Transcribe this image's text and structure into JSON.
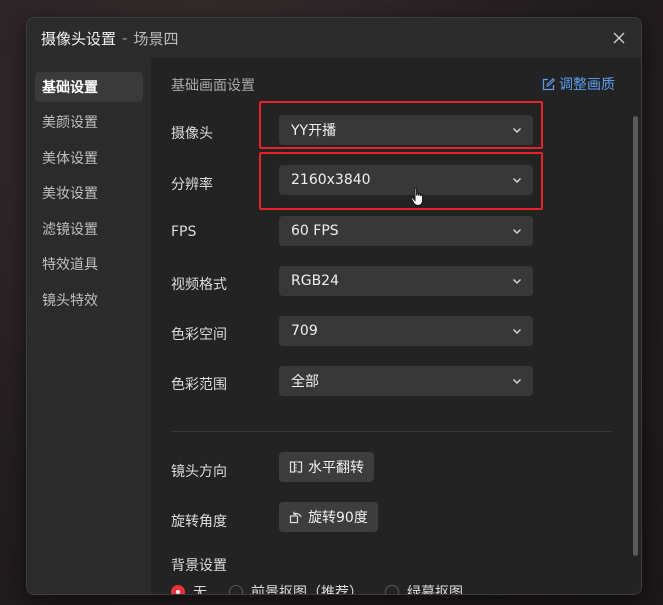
{
  "window": {
    "title": "摄像头设置",
    "separator": "-",
    "subtitle": "场景四"
  },
  "sidebar": {
    "items": [
      {
        "label": "基础设置",
        "active": true
      },
      {
        "label": "美颜设置"
      },
      {
        "label": "美体设置"
      },
      {
        "label": "美妆设置"
      },
      {
        "label": "滤镜设置"
      },
      {
        "label": "特效道具"
      },
      {
        "label": "镜头特效"
      }
    ]
  },
  "main": {
    "section_title": "基础画面设置",
    "adjust_link": "调整画质",
    "fields": [
      {
        "label": "摄像头",
        "value": "YY开播"
      },
      {
        "label": "分辨率",
        "value": "2160x3840"
      },
      {
        "label": "FPS",
        "value": "60 FPS"
      },
      {
        "label": "视频格式",
        "value": "RGB24"
      },
      {
        "label": "色彩空间",
        "value": "709"
      },
      {
        "label": "色彩范围",
        "value": "全部"
      }
    ],
    "lens_direction": {
      "label": "镜头方向",
      "button": "水平翻转"
    },
    "rotation": {
      "label": "旋转角度",
      "button": "旋转90度"
    },
    "background": {
      "label": "背景设置",
      "options": [
        {
          "label": "无",
          "checked": true
        },
        {
          "label": "前景抠图（推荐）"
        },
        {
          "label": "绿幕抠图"
        }
      ]
    }
  },
  "colors": {
    "accent_link": "#5b9cf0",
    "highlight_box": "#e8222a",
    "radio_checked": "#e8323a"
  }
}
